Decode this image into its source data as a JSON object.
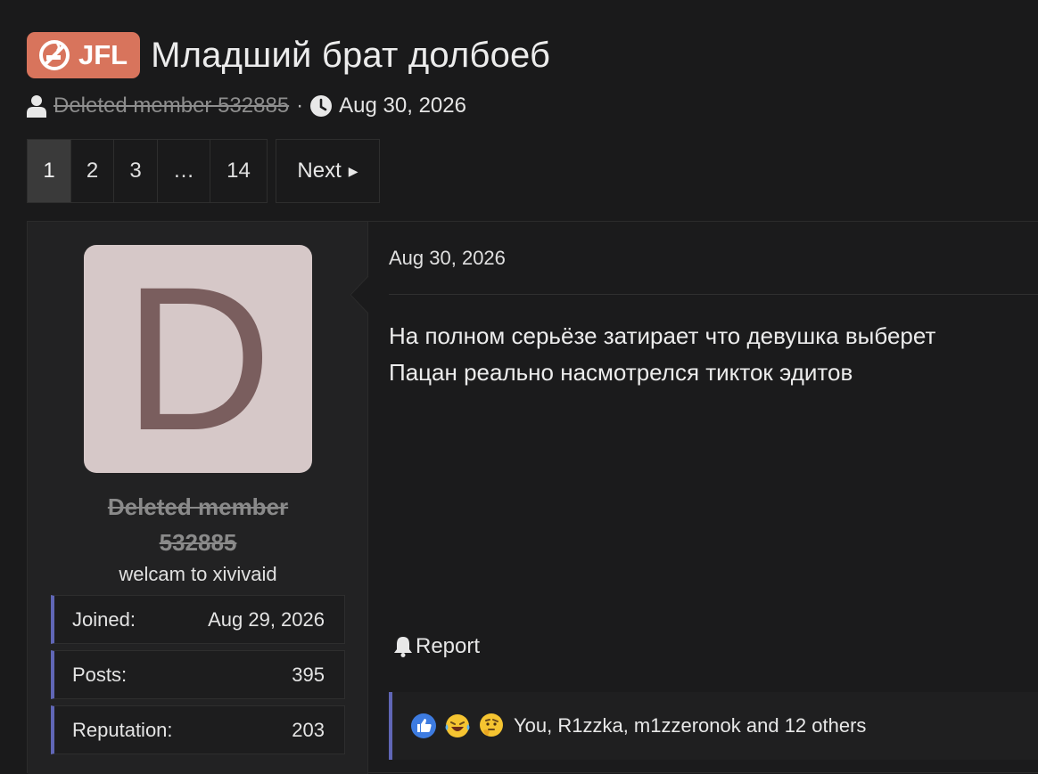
{
  "thread": {
    "prefix": "JFL",
    "title": "Младший брат долбоеб",
    "author": "Deleted member 532885",
    "separator": "·",
    "date": "Aug 30, 2026"
  },
  "pagination": {
    "pages": [
      "1",
      "2",
      "3",
      "…",
      "14"
    ],
    "current": "1",
    "next_label": "Next"
  },
  "post": {
    "avatar_letter": "D",
    "username_line1": "Deleted member",
    "username_line2": "532885",
    "user_title": "welcam to xivivaid",
    "stats": [
      {
        "label": "Joined:",
        "value": "Aug 29, 2026"
      },
      {
        "label": "Posts:",
        "value": "395"
      },
      {
        "label": "Reputation:",
        "value": "203"
      }
    ],
    "date": "Aug 30, 2026",
    "message_lines": [
      "На полном серьёзе затирает что девушка выберет",
      "Пацан реально насмотрелся тикток эдитов"
    ],
    "report_label": "Report",
    "reactions": {
      "icons": [
        "like-emoji",
        "laugh-cry-emoji",
        "thinking-emoji"
      ],
      "summary": "You, R1zzka, m1zzeronok and 12 others"
    }
  },
  "colors": {
    "prefix_bg": "#d8745c",
    "accent_bar": "#6066b6",
    "avatar_bg": "#d6c8c8",
    "avatar_letter": "#7a5e5e",
    "background": "#1a1a1b"
  }
}
